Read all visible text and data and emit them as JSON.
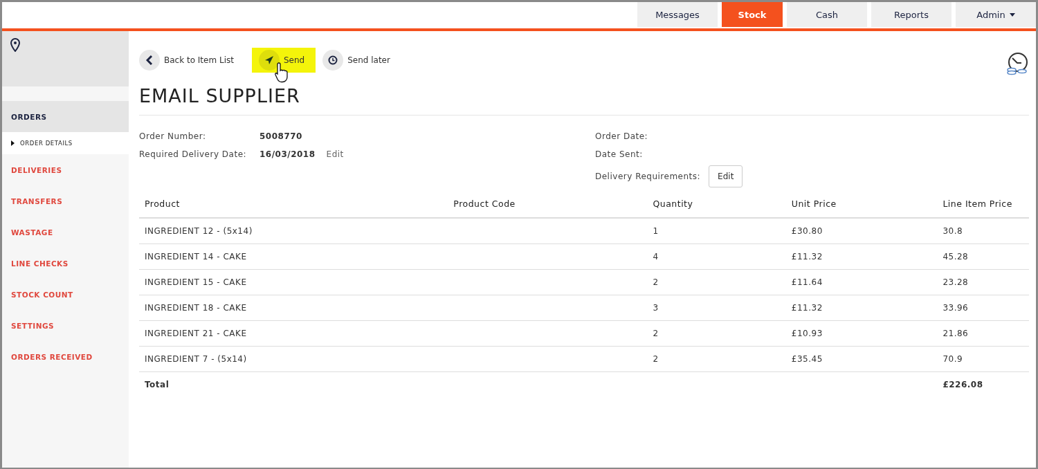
{
  "nav_tabs": [
    {
      "label": "Messages",
      "selected": false,
      "dropdown": false
    },
    {
      "label": "Stock",
      "selected": true,
      "dropdown": false
    },
    {
      "label": "Cash",
      "selected": false,
      "dropdown": false
    },
    {
      "label": "Reports",
      "selected": false,
      "dropdown": false
    },
    {
      "label": "Admin",
      "selected": false,
      "dropdown": true
    }
  ],
  "sidebar": {
    "items": [
      {
        "label": "ORDERS",
        "selected": true,
        "children": [
          {
            "label": "ORDER DETAILS",
            "selected": true
          }
        ]
      },
      {
        "label": "DELIVERIES",
        "selected": false
      },
      {
        "label": "TRANSFERS",
        "selected": false
      },
      {
        "label": "WASTAGE",
        "selected": false
      },
      {
        "label": "LINE CHECKS",
        "selected": false
      },
      {
        "label": "STOCK COUNT",
        "selected": false
      },
      {
        "label": "SETTINGS",
        "selected": false
      },
      {
        "label": "ORDERS RECEIVED",
        "selected": false
      }
    ]
  },
  "toolbar": [
    {
      "kind": "back",
      "label": "Back to Item List",
      "highlighted": false
    },
    {
      "kind": "send",
      "label": "Send",
      "highlighted": true
    },
    {
      "kind": "later",
      "label": "Send later",
      "highlighted": false
    }
  ],
  "title": "EMAIL SUPPLIER",
  "details_left": [
    {
      "label": "Order Number:",
      "value": "5008770"
    },
    {
      "label": "Required Delivery Date:",
      "value": "16/03/2018",
      "link": "Edit"
    }
  ],
  "details_right": [
    {
      "label": "Order Date:"
    },
    {
      "label": "Date Sent:"
    },
    {
      "label": "Delivery Requirements:",
      "button": "Edit"
    }
  ],
  "table": {
    "columns": [
      "Product",
      "Product Code",
      "Quantity",
      "Unit Price",
      "Line Item Price"
    ],
    "rows": [
      [
        "INGREDIENT 12 - (5x14)",
        "",
        "1",
        "£30.80",
        "30.8"
      ],
      [
        "INGREDIENT 14 - CAKE",
        "",
        "4",
        "£11.32",
        "45.28"
      ],
      [
        "INGREDIENT 15 - CAKE",
        "",
        "2",
        "£11.64",
        "23.28"
      ],
      [
        "INGREDIENT 18 - CAKE",
        "",
        "3",
        "£11.32",
        "33.96"
      ],
      [
        "INGREDIENT 21 - CAKE",
        "",
        "2",
        "£10.93",
        "21.86"
      ],
      [
        "INGREDIENT 7 - (5x14)",
        "",
        "2",
        "£35.45",
        "70.9"
      ]
    ],
    "total": {
      "label": "Total",
      "value": "£226.08"
    }
  }
}
